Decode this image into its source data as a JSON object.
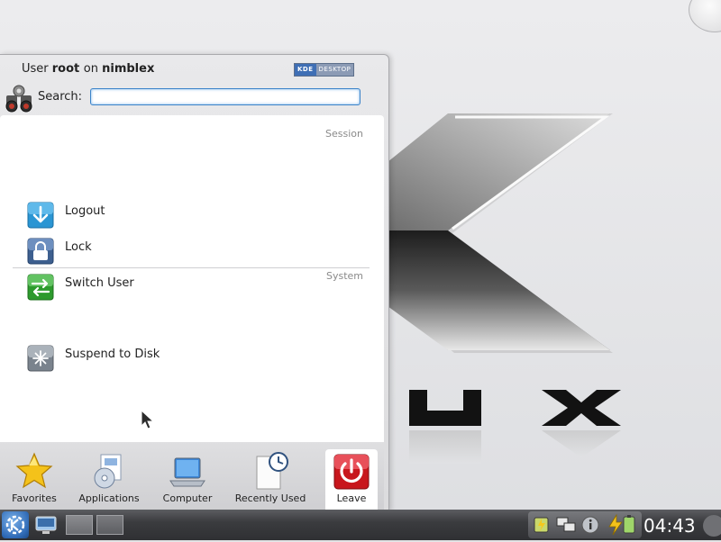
{
  "menu": {
    "header": {
      "prefix": "User",
      "user": "root",
      "middle": "on",
      "host": "nimblex"
    },
    "badge": {
      "k": "KDE",
      "d": "DESKTOP"
    },
    "search": {
      "label": "Search:",
      "value": "",
      "placeholder": ""
    },
    "sections": [
      {
        "title": "Session",
        "items": [
          {
            "label": "Logout",
            "icon": "logout-icon"
          },
          {
            "label": "Lock",
            "icon": "lock-icon"
          },
          {
            "label": "Switch User",
            "icon": "switch-user-icon"
          }
        ]
      },
      {
        "title": "System",
        "items": [
          {
            "label": "Suspend to Disk",
            "icon": "suspend-icon"
          }
        ]
      }
    ],
    "tabs": [
      {
        "label": "Favorites",
        "icon": "star-icon"
      },
      {
        "label": "Applications",
        "icon": "applications-icon"
      },
      {
        "label": "Computer",
        "icon": "computer-icon"
      },
      {
        "label": "Recently Used",
        "icon": "recent-document-icon"
      },
      {
        "label": "Leave",
        "icon": "power-icon",
        "active": true
      }
    ]
  },
  "panel": {
    "clock": "04:43",
    "tray_icons": [
      "battery-icon",
      "network-icon",
      "info-icon",
      "power-plug-icon"
    ]
  },
  "colors": {
    "accent": "#3b83c9",
    "leave": "#c8161c",
    "panel": "#3b3c3f"
  }
}
